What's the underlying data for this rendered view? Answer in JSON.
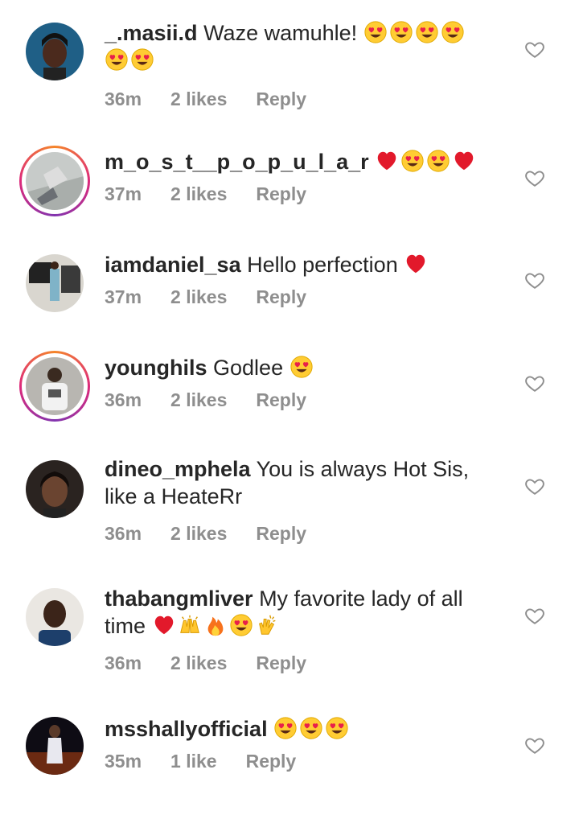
{
  "comments": [
    {
      "username": "_.masii.d",
      "text": "Waze wamuhle!",
      "emoji": [
        "heart-eyes",
        "heart-eyes",
        "heart-eyes",
        "heart-eyes",
        "heart-eyes",
        "heart-eyes"
      ],
      "time": "36m",
      "likes": "2 likes",
      "reply": "Reply",
      "story_ring": false
    },
    {
      "username": "m_o_s_t__p_o_p_u_l_a_r",
      "text": "",
      "emoji": [
        "red-heart",
        "heart-eyes",
        "heart-eyes",
        "red-heart"
      ],
      "time": "37m",
      "likes": "2 likes",
      "reply": "Reply",
      "story_ring": true
    },
    {
      "username": "iamdaniel_sa",
      "text": "Hello perfection",
      "emoji": [
        "red-heart"
      ],
      "time": "37m",
      "likes": "2 likes",
      "reply": "Reply",
      "story_ring": false
    },
    {
      "username": "younghils",
      "text": "Godlee",
      "emoji": [
        "heart-eyes"
      ],
      "time": "36m",
      "likes": "2 likes",
      "reply": "Reply",
      "story_ring": true
    },
    {
      "username": "dineo_mphela",
      "text": "You is always Hot Sis, like a HeateRr",
      "emoji": [],
      "time": "36m",
      "likes": "2 likes",
      "reply": "Reply",
      "story_ring": false
    },
    {
      "username": "thabangmliver",
      "text": "My favorite lady of all time",
      "emoji": [
        "red-heart",
        "raising-hands",
        "fire",
        "heart-eyes",
        "clapping-hands"
      ],
      "time": "36m",
      "likes": "2 likes",
      "reply": "Reply",
      "story_ring": false
    },
    {
      "username": "msshallyofficial",
      "text": "",
      "emoji": [
        "heart-eyes",
        "heart-eyes",
        "heart-eyes"
      ],
      "time": "35m",
      "likes": "1 like",
      "reply": "Reply",
      "story_ring": false
    }
  ],
  "colors": {
    "text": "#262626",
    "meta": "#8e8e8e",
    "heart_outline": "#8e8e8e"
  },
  "icons": {
    "like": "heart-outline-icon"
  }
}
